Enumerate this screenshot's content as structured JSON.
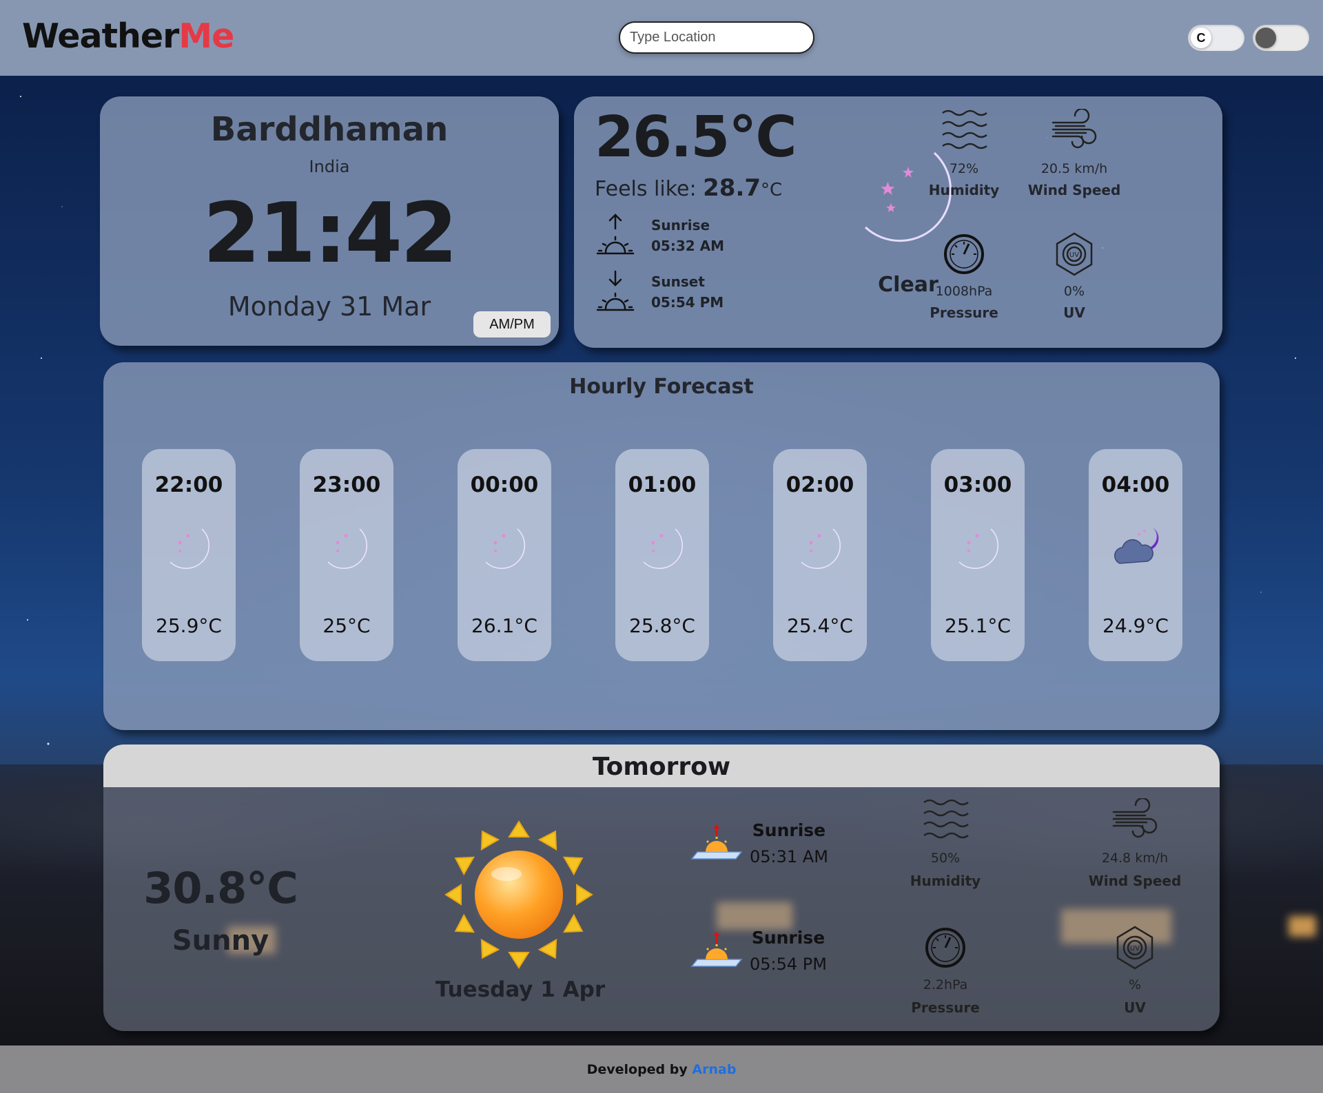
{
  "header": {
    "logo_main": "Weather",
    "logo_accent": "Me",
    "search_placeholder": "Type Location",
    "unit_toggle_label": "C"
  },
  "current": {
    "city": "Barddhaman",
    "country": "India",
    "time": "21:42",
    "date": "Monday 31 Mar",
    "ampm_button": "AM/PM",
    "temperature": "26.5°C",
    "feels_like_label": "Feels like:",
    "feels_like_value": "28.7",
    "feels_like_unit": "°C",
    "sunrise_label": "Sunrise",
    "sunrise_time": "05:32 AM",
    "sunset_label": "Sunset",
    "sunset_time": "05:54 PM",
    "condition": "Clear",
    "stats": {
      "humidity": {
        "value": "72%",
        "label": "Humidity"
      },
      "wind": {
        "value": "20.5 km/h",
        "label": "Wind Speed"
      },
      "pressure": {
        "value": "1008hPa",
        "label": "Pressure"
      },
      "uv": {
        "value": "0%",
        "label": "UV"
      }
    }
  },
  "hourly": {
    "title": "Hourly Forecast",
    "items": [
      {
        "time": "22:00",
        "temp": "25.9°C",
        "icon": "moon-stars-icon"
      },
      {
        "time": "23:00",
        "temp": "25°C",
        "icon": "moon-stars-icon"
      },
      {
        "time": "00:00",
        "temp": "26.1°C",
        "icon": "moon-stars-icon"
      },
      {
        "time": "01:00",
        "temp": "25.8°C",
        "icon": "moon-stars-icon"
      },
      {
        "time": "02:00",
        "temp": "25.4°C",
        "icon": "moon-stars-icon"
      },
      {
        "time": "03:00",
        "temp": "25.1°C",
        "icon": "moon-stars-icon"
      },
      {
        "time": "04:00",
        "temp": "24.9°C",
        "icon": "moon-cloud-icon"
      }
    ]
  },
  "tomorrow": {
    "title": "Tomorrow",
    "temperature": "30.8°C",
    "condition": "Sunny",
    "date": "Tuesday 1 Apr",
    "sunrise_label": "Sunrise",
    "sunrise_time": "05:31 AM",
    "sunset_label": "Sunrise",
    "sunset_time": "05:54 PM",
    "stats": {
      "humidity": {
        "value": "50%",
        "label": "Humidity"
      },
      "wind": {
        "value": "24.8 km/h",
        "label": "Wind Speed"
      },
      "pressure": {
        "value": "2.2hPa",
        "label": "Pressure"
      },
      "uv": {
        "value": "%",
        "label": "UV"
      }
    }
  },
  "footer": {
    "prefix": "Developed by",
    "author": "Arnab"
  },
  "colors": {
    "accent": "#e53946",
    "header_bg": "#8797b2",
    "link": "#1e6fe0",
    "moon_purple": "#7a2bd0"
  }
}
